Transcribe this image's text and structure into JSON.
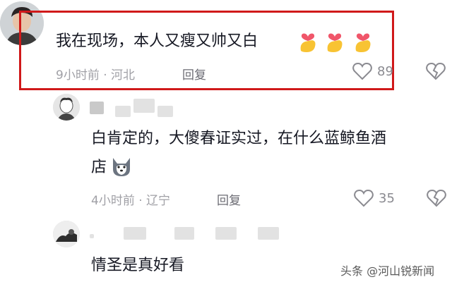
{
  "comment1": {
    "text": "我在现场，本人又瘦又帅又白",
    "emojis": [
      "finger-heart-emoji",
      "finger-heart-emoji",
      "finger-heart-emoji"
    ],
    "time_location": "9小时前 · 河北",
    "reply_label": "回复",
    "like_count": "89",
    "highlight_color": "#d0191a"
  },
  "comment2": {
    "text_line1": "白肯定的，大傻春证实过，在什么蓝鲸鱼酒",
    "text_line2": "店",
    "emoji": "husky-dog-emoji",
    "time_location": "4小时前 · 辽宁",
    "reply_label": "回复",
    "like_count": "35"
  },
  "comment3": {
    "text": "情圣是真好看"
  },
  "watermark": {
    "text": "头条 @河山锐新闻"
  }
}
